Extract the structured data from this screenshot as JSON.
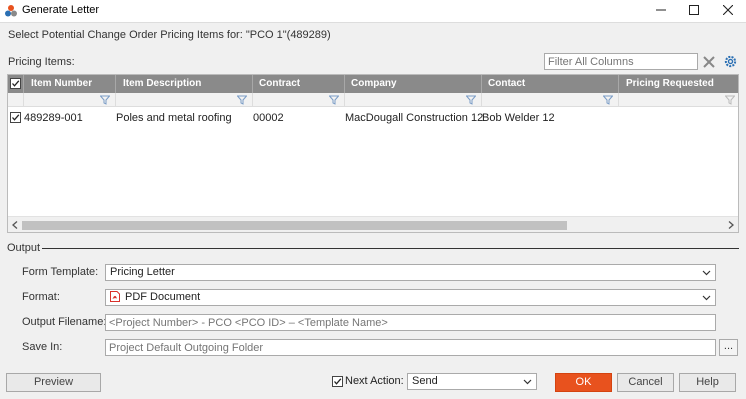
{
  "window": {
    "title": "Generate Letter"
  },
  "header": {
    "select_text": "Select Potential Change Order Pricing Items for: \"PCO 1\"(489289)",
    "pricing_items_label": "Pricing Items:",
    "filter_placeholder": "Filter All Columns"
  },
  "grid": {
    "columns": [
      "Item Number",
      "Item Description",
      "Contract",
      "Company",
      "Contact",
      "Pricing Requested"
    ],
    "rows": [
      {
        "checked": true,
        "item_number": "489289-001",
        "item_description": "Poles and metal roofing",
        "contract": "00002",
        "company": "MacDougall Construction 12",
        "contact": "Bob Welder 12",
        "pricing_requested": ""
      }
    ]
  },
  "output": {
    "section_label": "Output",
    "form_template_label": "Form Template:",
    "form_template_value": "Pricing Letter",
    "format_label": "Format:",
    "format_value": "PDF Document",
    "output_filename_label": "Output Filename:",
    "output_filename_placeholder": "<Project Number> - PCO <PCO ID> – <Template Name>",
    "save_in_label": "Save In:",
    "save_in_placeholder": "Project Default Outgoing Folder",
    "browse_label": "..."
  },
  "footer": {
    "preview_label": "Preview",
    "next_action_label": "Next Action:",
    "next_action_checked": true,
    "next_action_value": "Send",
    "ok_label": "OK",
    "cancel_label": "Cancel",
    "help_label": "Help"
  },
  "colors": {
    "header_bg": "#8a8a8a",
    "ok_button": "#e8521e",
    "pdf_icon": "#d9312b",
    "settings_icon": "#2a6fb3"
  }
}
